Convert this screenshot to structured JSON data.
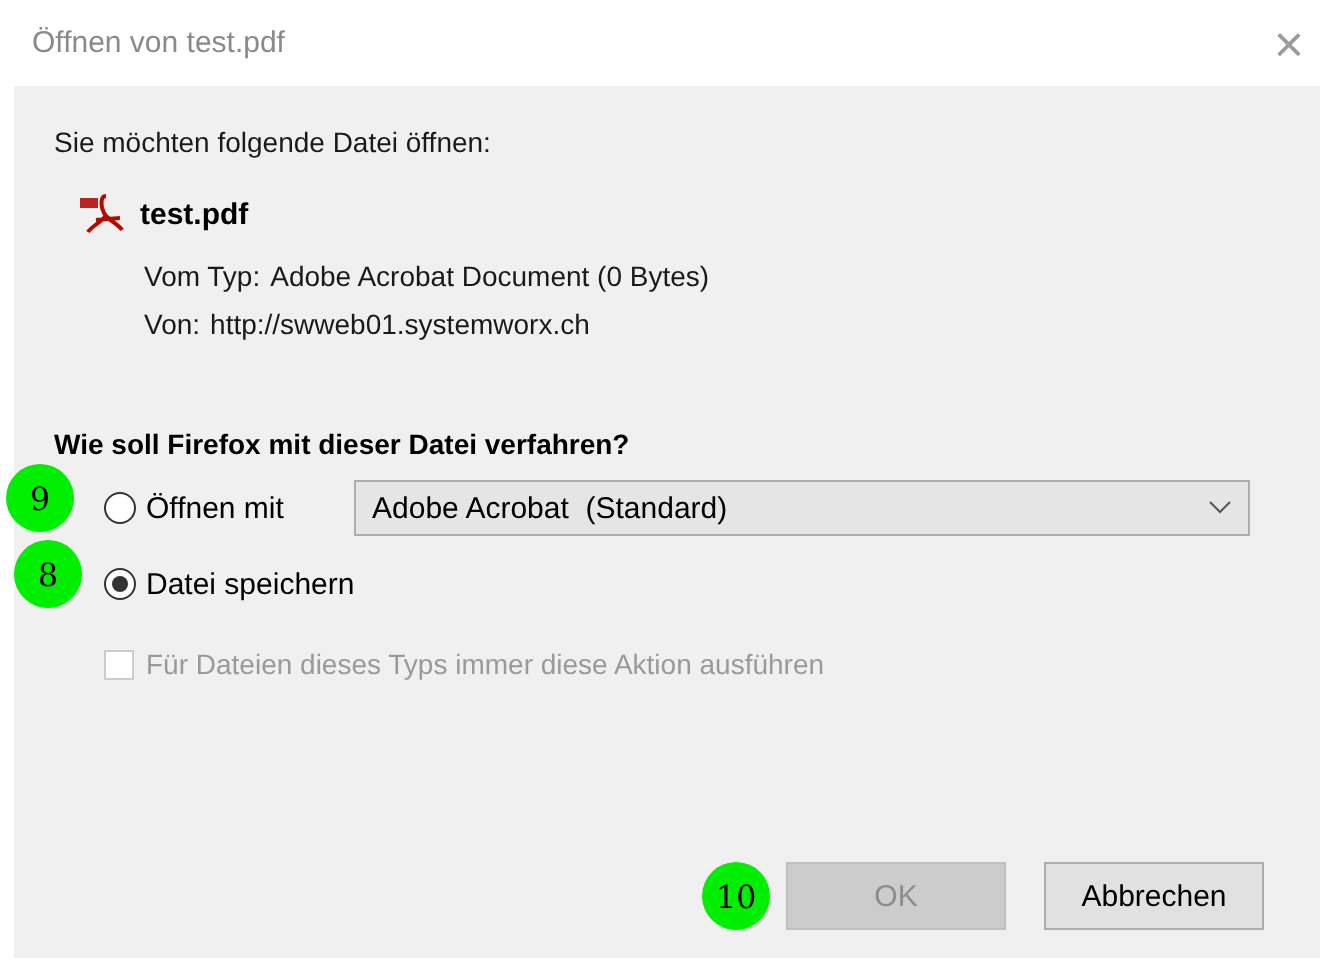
{
  "window": {
    "title": "Öffnen von test.pdf",
    "close": "×"
  },
  "intro": "Sie möchten folgende Datei öffnen:",
  "file": {
    "name": "test.pdf",
    "type_label": "Vom Typ:",
    "type": "Adobe Acrobat Document (0 Bytes)",
    "from_label": "Von:",
    "from": "http://swweb01.systemworx.ch"
  },
  "question": "Wie soll Firefox mit dieser Datei verfahren?",
  "options": [
    {
      "kind": "open",
      "label": "Öffnen mit",
      "selected": false,
      "annotation": "9",
      "dropdown": {
        "value": "Adobe Acrobat  (Standard)",
        "disabled": false
      }
    },
    {
      "kind": "save",
      "label": "Datei speichern",
      "selected": true,
      "annotation": "8"
    }
  ],
  "always": {
    "label": "Für Dateien dieses Typs immer diese Aktion ausführen",
    "checked": false,
    "disabled": true
  },
  "buttons": [
    {
      "label": "OK",
      "disabled": true,
      "annotation": "10"
    },
    {
      "label": "Abbrechen",
      "disabled": false
    }
  ]
}
